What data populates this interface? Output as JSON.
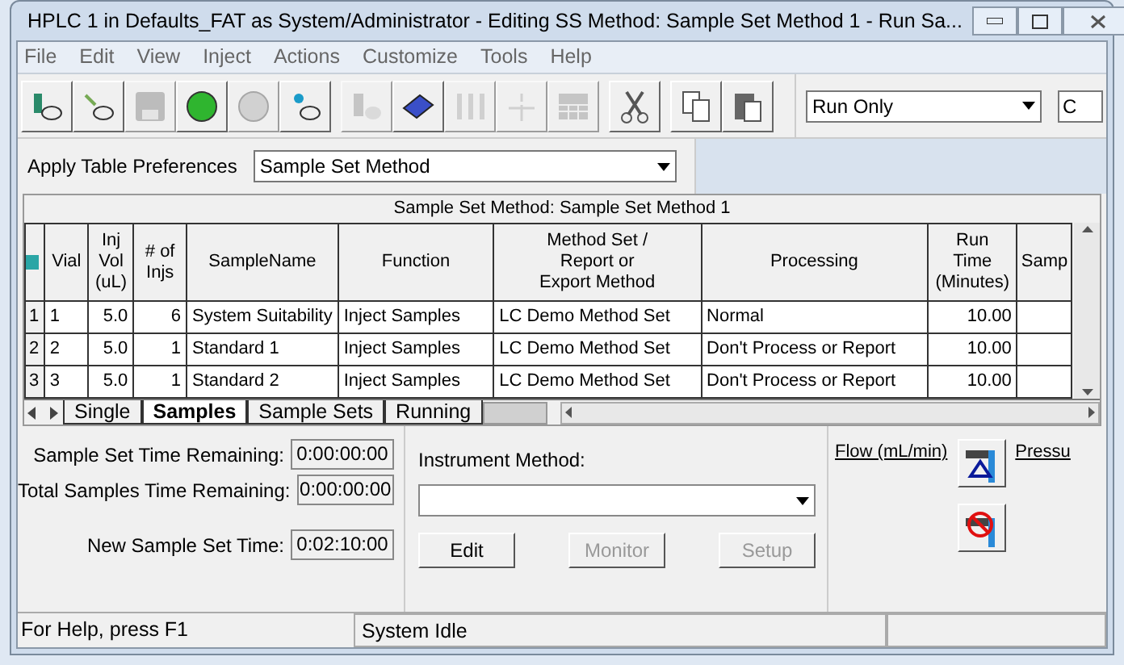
{
  "window": {
    "title": "HPLC 1 in Defaults_FAT as System/Administrator - Editing SS Method: Sample Set Method 1 - Run Sa..."
  },
  "menu": [
    "File",
    "Edit",
    "View",
    "Inject",
    "Actions",
    "Customize",
    "Tools",
    "Help"
  ],
  "toolbar": [
    {
      "disabled": false
    },
    {
      "disabled": false
    },
    {
      "disabled": true
    },
    {
      "disabled": false
    },
    {
      "disabled": true
    },
    {
      "disabled": false
    },
    {
      "disabled": true
    },
    {
      "disabled": false
    },
    {
      "disabled": true
    },
    {
      "disabled": true
    },
    {
      "disabled": true
    },
    {
      "disabled": false
    },
    {
      "disabled": false
    },
    {
      "disabled": false
    }
  ],
  "mode_select": {
    "value": "Run Only"
  },
  "partial_field": {
    "value": "C"
  },
  "table_preferences": {
    "label": "Apply Table Preferences",
    "value": "Sample Set Method"
  },
  "table": {
    "title": "Sample Set Method: Sample Set Method 1",
    "columns": [
      "Vial",
      "Inj\nVol\n(uL)",
      "# of\nInjs",
      "SampleName",
      "Function",
      "Method Set /\nReport or\nExport Method",
      "Processing",
      "Run\nTime\n(Minutes)",
      "Samp"
    ],
    "rows": [
      {
        "number": "1",
        "cells": [
          "1",
          "5.0",
          "6",
          "System Suitability",
          "Inject Samples",
          "LC Demo Method Set",
          "Normal",
          "10.00",
          ""
        ]
      },
      {
        "number": "2",
        "cells": [
          "2",
          "5.0",
          "1",
          "Standard 1",
          "Inject Samples",
          "LC Demo Method Set",
          "Don't Process or Report",
          "10.00",
          ""
        ]
      },
      {
        "number": "3",
        "cells": [
          "3",
          "5.0",
          "1",
          "Standard 2",
          "Inject Samples",
          "LC Demo Method Set",
          "Don't Process or Report",
          "10.00",
          ""
        ]
      }
    ]
  },
  "tabs": [
    {
      "label": "Single",
      "selected": false
    },
    {
      "label": "Samples",
      "selected": true
    },
    {
      "label": "Sample Sets",
      "selected": false
    },
    {
      "label": "Running",
      "selected": false
    }
  ],
  "times": [
    {
      "label": "Sample Set Time Remaining:",
      "value": "0:00:00:00"
    },
    {
      "label": "Total Samples Time Remaining:",
      "value": "0:00:00:00"
    },
    {
      "label": "New Sample Set Time:",
      "value": "0:02:10:00"
    }
  ],
  "instrument_method": {
    "label": "Instrument Method:"
  },
  "buttons": [
    {
      "label": "Edit",
      "disabled": false
    },
    {
      "label": "Monitor",
      "disabled": true
    },
    {
      "label": "Setup",
      "disabled": true
    }
  ],
  "flow": {
    "label": "Flow (mL/min)",
    "pressure_label": "Pressu"
  },
  "status_bar": [
    "For Help, press F1",
    "System Idle"
  ]
}
